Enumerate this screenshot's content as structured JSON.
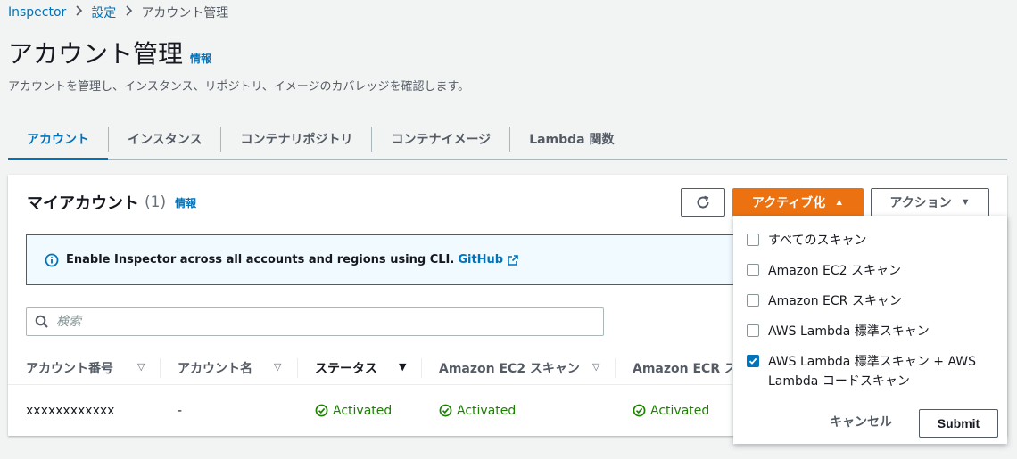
{
  "breadcrumb": {
    "root": "Inspector",
    "settings": "設定",
    "current": "アカウント管理"
  },
  "page": {
    "title": "アカウント管理",
    "info": "情報",
    "description": "アカウントを管理し、インスタンス、リポジトリ、イメージのカバレッジを確認します。"
  },
  "tabs": [
    {
      "label": "アカウント",
      "active": true
    },
    {
      "label": "インスタンス"
    },
    {
      "label": "コンテナリポジトリ"
    },
    {
      "label": "コンテナイメージ"
    },
    {
      "label": "Lambda 関数"
    }
  ],
  "panel": {
    "title": "マイアカウント",
    "count": "(1)",
    "info": "情報",
    "activate_label": "アクティブ化",
    "actions_label": "アクション"
  },
  "alert": {
    "text": "Enable Inspector across all accounts and regions using CLI.",
    "link": "GitHub"
  },
  "search": {
    "placeholder": "検索"
  },
  "table": {
    "columns": [
      "アカウント番号",
      "アカウント名",
      "ステータス",
      "Amazon EC2 スキャン",
      "Amazon ECR スキャン"
    ],
    "rows": [
      {
        "account_id": "xxxxxxxxxxxx",
        "account_name": "-",
        "status": "Activated",
        "ec2": "Activated",
        "ecr": "Activated"
      }
    ]
  },
  "dropdown": {
    "items": [
      {
        "label": "すべてのスキャン",
        "checked": false
      },
      {
        "label": "Amazon EC2 スキャン",
        "checked": false
      },
      {
        "label": "Amazon ECR スキャン",
        "checked": false
      },
      {
        "label": "AWS Lambda 標準スキャン",
        "checked": false
      },
      {
        "label_line1": "AWS Lambda 標準スキャン + AWS",
        "label_line2": "Lambda コードスキャン",
        "checked": true
      }
    ],
    "cancel": "キャンセル",
    "submit": "Submit"
  },
  "colors": {
    "accent": "#0073bb",
    "primary_button": "#ec7211",
    "success": "#1d8102"
  }
}
